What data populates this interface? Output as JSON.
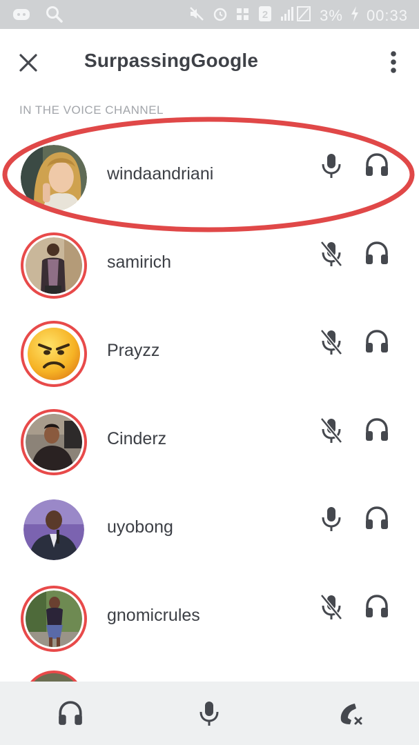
{
  "status_bar": {
    "battery": "3%",
    "time": "00:33",
    "sim": "2"
  },
  "header": {
    "title": "SurpassingGoogle",
    "close_icon": "close-icon",
    "more_icon": "more-vertical-icon"
  },
  "section_label": "IN THE VOICE CHANNEL",
  "users": [
    {
      "name": "windaandriani",
      "muted": false,
      "speaking": false,
      "highlighted": true
    },
    {
      "name": "samirich",
      "muted": true,
      "speaking": true
    },
    {
      "name": "Prayzz",
      "muted": true,
      "speaking": true
    },
    {
      "name": "Cinderz",
      "muted": true,
      "speaking": true
    },
    {
      "name": "uyobong",
      "muted": false,
      "speaking": false
    },
    {
      "name": "gnomicrules",
      "muted": true,
      "speaking": true
    }
  ],
  "bottom_bar": {
    "deafen_icon": "headphones-icon",
    "mute_icon": "microphone-icon",
    "disconnect_icon": "hang-up-icon"
  },
  "colors": {
    "speaking_ring": "#e84a4a",
    "highlight_annotation": "#e04848",
    "icon_dark": "#45484e",
    "status_bar_bg": "#cfd1d3",
    "bottom_bar_bg": "#eef0f1"
  }
}
